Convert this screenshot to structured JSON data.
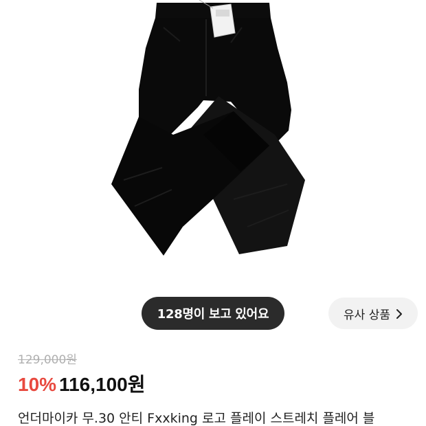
{
  "product": {
    "image_alt": "black flare jeans",
    "viewer_text": "128명이 보고 있어요",
    "similar_label": "유사 상품",
    "original_price": "129,000원",
    "discount": "10%",
    "sale_price": "116,100원",
    "title": "언더마이카 무.30 안티 Fxxking 로고 플레이 스트레치 플레어 블"
  },
  "icons": {
    "similar_chevron": "chevron-right-icon"
  },
  "colors": {
    "discount": "#e8493f",
    "viewer_pill_bg": "#2b2b2b",
    "similar_button_bg": "#f2f2f2",
    "original_price": "#b0b0b0"
  }
}
